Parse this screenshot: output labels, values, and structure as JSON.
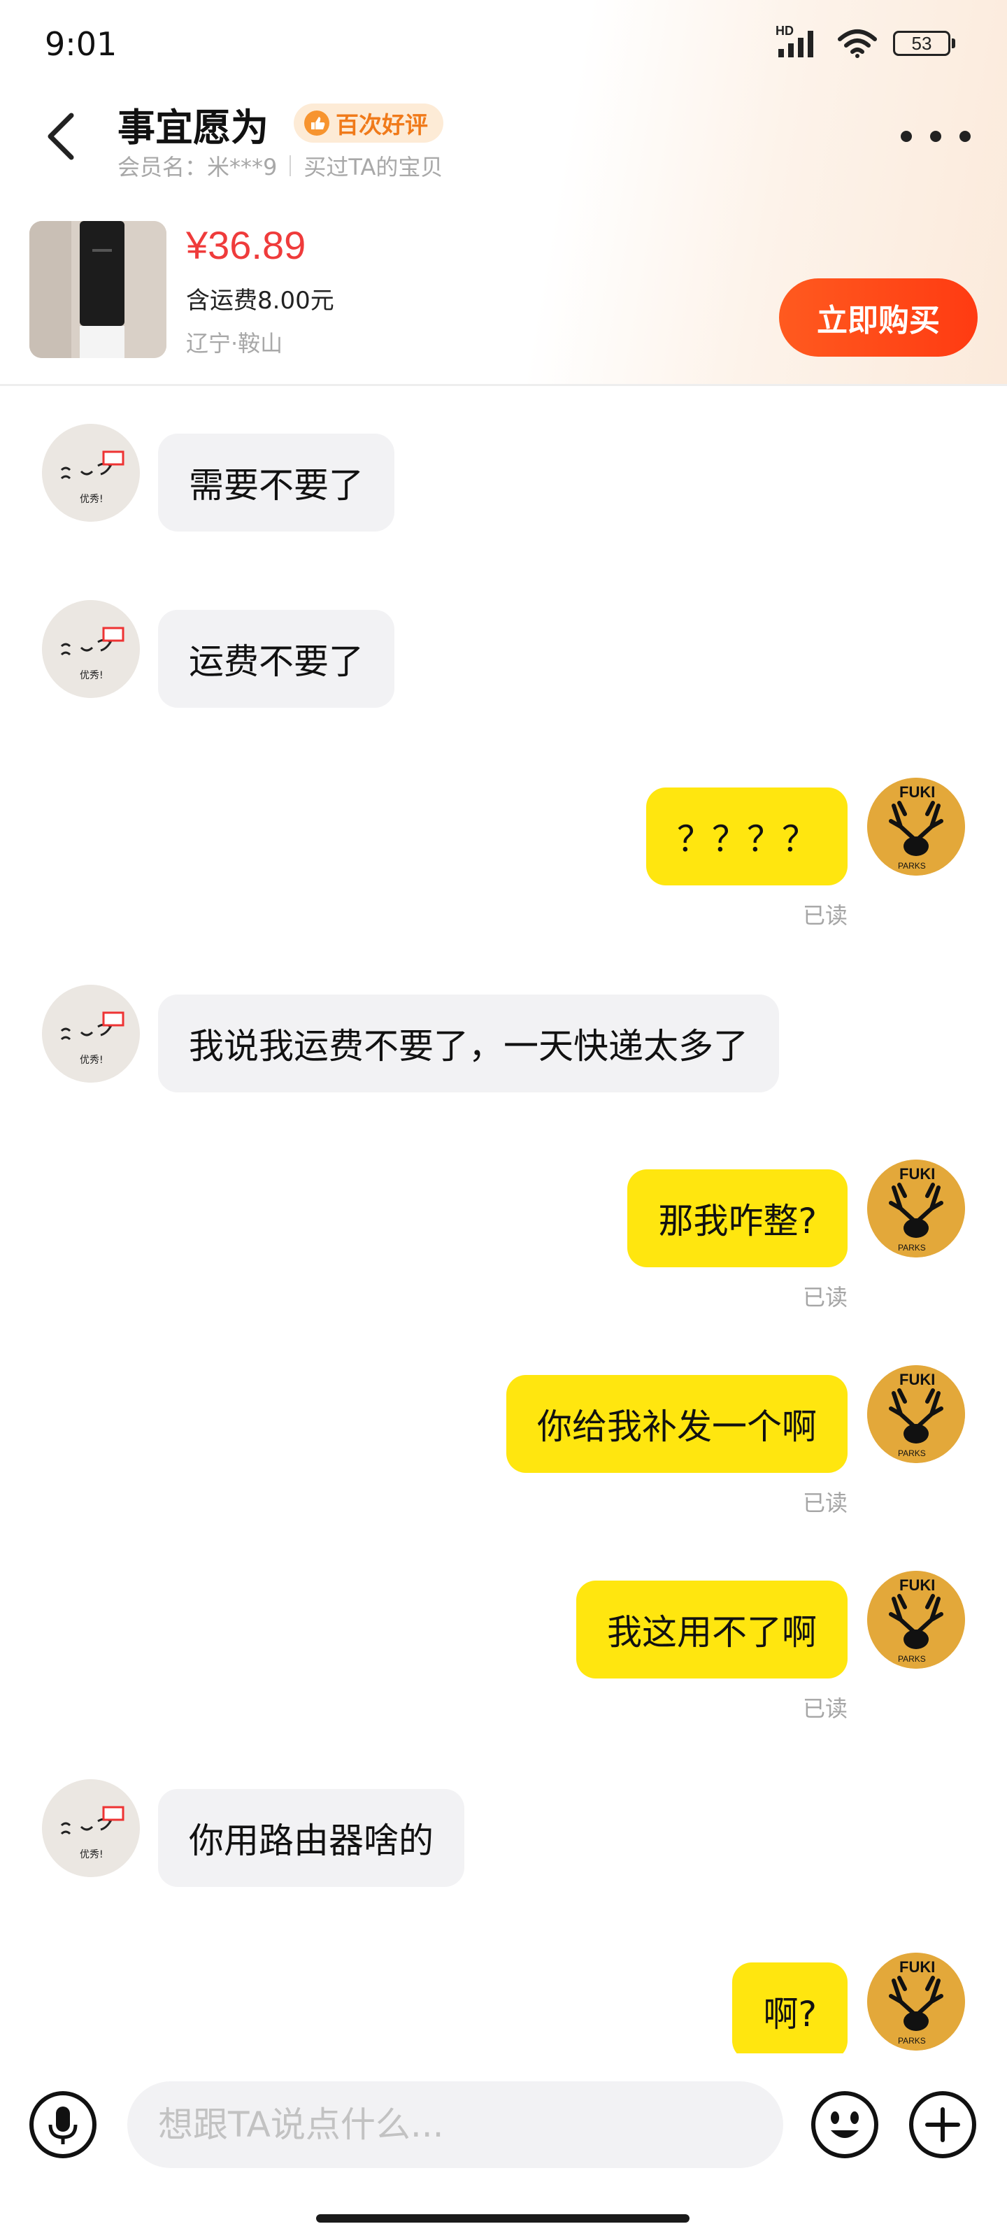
{
  "status_bar": {
    "time": "9:01",
    "signal_label": "HD",
    "battery": "53"
  },
  "header": {
    "shop_name": "事宜愿为",
    "badge": "百次好评",
    "member_name": "会员名：米***9",
    "bought_text": "买过TA的宝贝"
  },
  "product": {
    "price": "¥36.89",
    "shipping": "含运费8.00元",
    "location": "辽宁·鞍山",
    "buy_label": "立即购买"
  },
  "messages": [
    {
      "side": "in",
      "text": "需要不要了"
    },
    {
      "side": "in",
      "text": "运费不要了"
    },
    {
      "side": "out",
      "text": "？？？？",
      "status": "已读"
    },
    {
      "side": "in",
      "text": "我说我运费不要了，一天快递太多了"
    },
    {
      "side": "out",
      "text": "那我咋整?",
      "status": "已读"
    },
    {
      "side": "out",
      "text": "你给我补发一个啊",
      "status": "已读"
    },
    {
      "side": "out",
      "text": "我这用不了啊",
      "status": "已读"
    },
    {
      "side": "in",
      "text": "你用路由器啥的"
    },
    {
      "side": "out",
      "text": "啊?"
    }
  ],
  "input": {
    "placeholder": "想跟TA说点什么..."
  },
  "avatar_texts": {
    "left_caption": "优秀!",
    "right_top": "FUKI",
    "right_bottom": "PARKS"
  },
  "colors": {
    "accent_buy": "#ff4a17",
    "price": "#ef3b3b",
    "outgoing_bubble": "#ffe60f",
    "incoming_bubble": "#f2f2f4"
  }
}
